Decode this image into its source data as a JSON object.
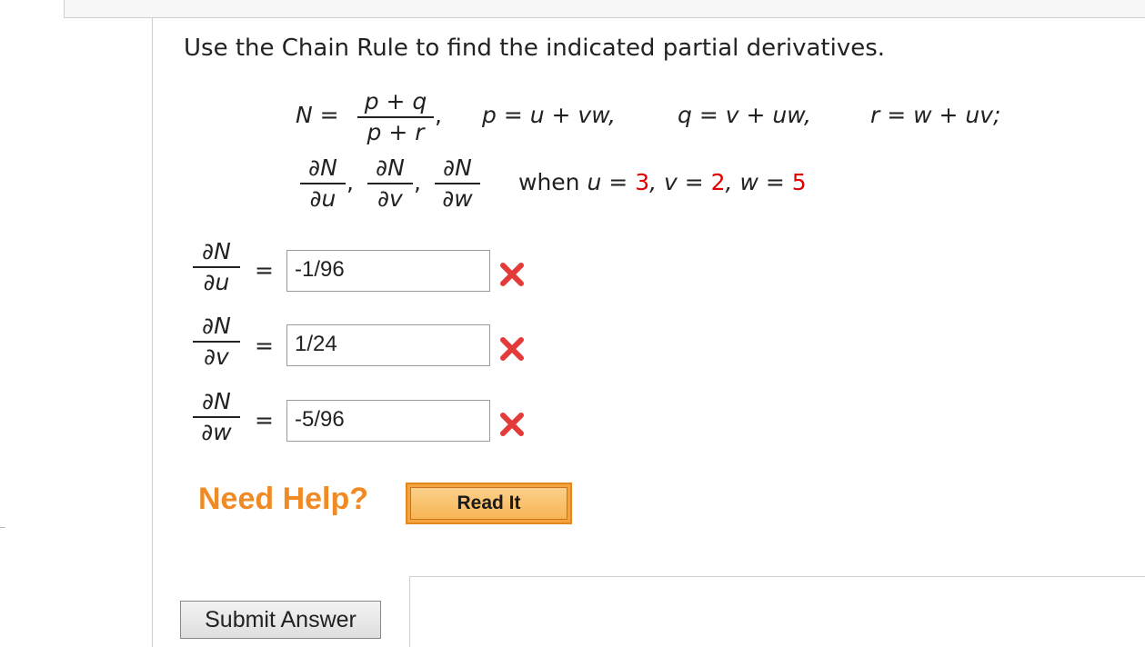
{
  "question": {
    "instruction": "Use the Chain Rule to find the indicated partial derivatives.",
    "definition": {
      "N_label": "N =",
      "N_num": "p + q",
      "N_den": "p + r",
      "comma": ",",
      "p_def": "p = u + vw,",
      "q_def": "q = v + uw,",
      "r_def": "r = w + uv;"
    },
    "targets": {
      "dN": "∂N",
      "du": "∂u",
      "dv": "∂v",
      "dw": "∂w",
      "sep": ","
    },
    "condition": {
      "when": "when",
      "u_label": "u =",
      "u_value": "3",
      "v_label": ", v =",
      "v_value": "2",
      "w_label": ", w =",
      "w_value": "5"
    }
  },
  "answers": [
    {
      "num": "∂N",
      "den": "∂u",
      "eq": "=",
      "value": "-1/96",
      "status": "incorrect"
    },
    {
      "num": "∂N",
      "den": "∂v",
      "eq": "=",
      "value": "1/24",
      "status": "incorrect"
    },
    {
      "num": "∂N",
      "den": "∂w",
      "eq": "=",
      "value": "-5/96",
      "status": "incorrect"
    }
  ],
  "help": {
    "label": "Need Help?",
    "read_it": "Read It"
  },
  "submit_label": "Submit Answer",
  "colors": {
    "help": "#f08a24",
    "incorrect": "#e33a3a",
    "given_values": "#e00000"
  }
}
